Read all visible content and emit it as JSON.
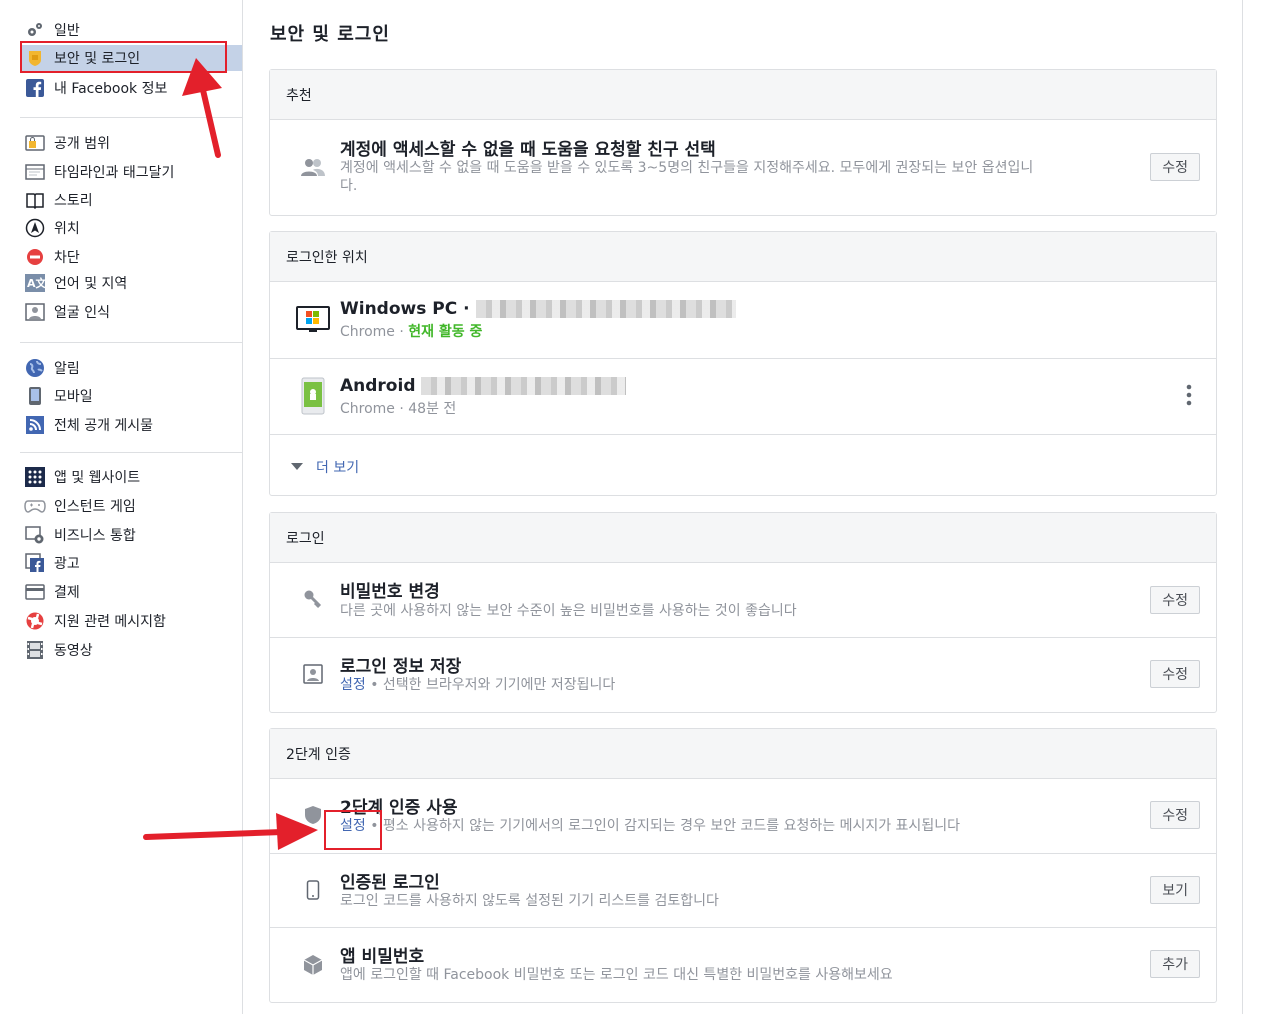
{
  "sidebar": {
    "items": [
      {
        "label": "일반",
        "icon": "gears-icon"
      },
      {
        "label": "보안 및 로그인",
        "icon": "shield-badge-icon"
      },
      {
        "label": "내 Facebook 정보",
        "icon": "facebook-icon"
      },
      {
        "label": "공개 범위",
        "icon": "lock-privacy-icon"
      },
      {
        "label": "타임라인과 태그달기",
        "icon": "timeline-icon"
      },
      {
        "label": "스토리",
        "icon": "book-icon"
      },
      {
        "label": "위치",
        "icon": "location-icon"
      },
      {
        "label": "차단",
        "icon": "block-icon"
      },
      {
        "label": "언어 및 지역",
        "icon": "language-icon"
      },
      {
        "label": "얼굴 인식",
        "icon": "face-icon"
      },
      {
        "label": "알림",
        "icon": "globe-icon"
      },
      {
        "label": "모바일",
        "icon": "mobile-icon"
      },
      {
        "label": "전체 공개 게시물",
        "icon": "rss-icon"
      },
      {
        "label": "앱 및 웹사이트",
        "icon": "apps-icon"
      },
      {
        "label": "인스턴트 게임",
        "icon": "gamepad-icon"
      },
      {
        "label": "비즈니스 통합",
        "icon": "business-icon"
      },
      {
        "label": "광고",
        "icon": "ads-icon"
      },
      {
        "label": "결제",
        "icon": "card-icon"
      },
      {
        "label": "지원 관련 메시지함",
        "icon": "lifebuoy-icon"
      },
      {
        "label": "동영상",
        "icon": "film-icon"
      }
    ]
  },
  "main": {
    "title": "보안 및 로그인",
    "recommended": {
      "header": "추천",
      "title": "계정에 액세스할 수 없을 때 도움을 요청할 친구 선택",
      "desc_line1": "계정에 액세스할 수 없을 때 도움을 받을 수 있도록 3~5명의 친구들을 지정해주세요. 모두에게 권장되는 보안 옵션입니",
      "desc_line2": "다.",
      "button": "수정"
    },
    "where_logged_in": {
      "header": "로그인한 위치",
      "devices": [
        {
          "name": "Windows PC ·",
          "browser": "Chrome · ",
          "status": "현재 활동 중"
        },
        {
          "name": "Android",
          "browser": "Chrome · 48분 전",
          "status": ""
        }
      ],
      "more": "더 보기"
    },
    "login": {
      "header": "로그인",
      "items": [
        {
          "title": "비밀번호 변경",
          "desc": "다른 곳에 사용하지 않는 보안 수준이 높은 비밀번호를 사용하는 것이 좋습니다",
          "button": "수정"
        },
        {
          "title": "로그인 정보 저장",
          "link": "설정",
          "desc": " • 선택한 브라우저와 기기에만 저장됩니다",
          "button": "수정"
        }
      ]
    },
    "two_factor": {
      "header": "2단계 인증",
      "items": [
        {
          "title": "2단계 인증 사용",
          "link": "설정",
          "desc": " • 평소 사용하지 않는 기기에서의 로그인이 감지되는 경우 보안 코드를 요청하는 메시지가 표시됩니다",
          "button": "수정"
        },
        {
          "title": "인증된 로그인",
          "desc": "로그인 코드를 사용하지 않도록 설정된 기기 리스트를 검토합니다",
          "button": "보기"
        },
        {
          "title": "앱 비밀번호",
          "desc": "앱에 로그인할 때 Facebook 비밀번호 또는 로그인 코드 대신 특별한 비밀번호를 사용해보세요",
          "button": "추가"
        }
      ]
    }
  },
  "colors": {
    "accent": "#4267b2",
    "active_bg": "#c4d2e7",
    "annotation": "#e3202b",
    "green": "#42b72a"
  }
}
